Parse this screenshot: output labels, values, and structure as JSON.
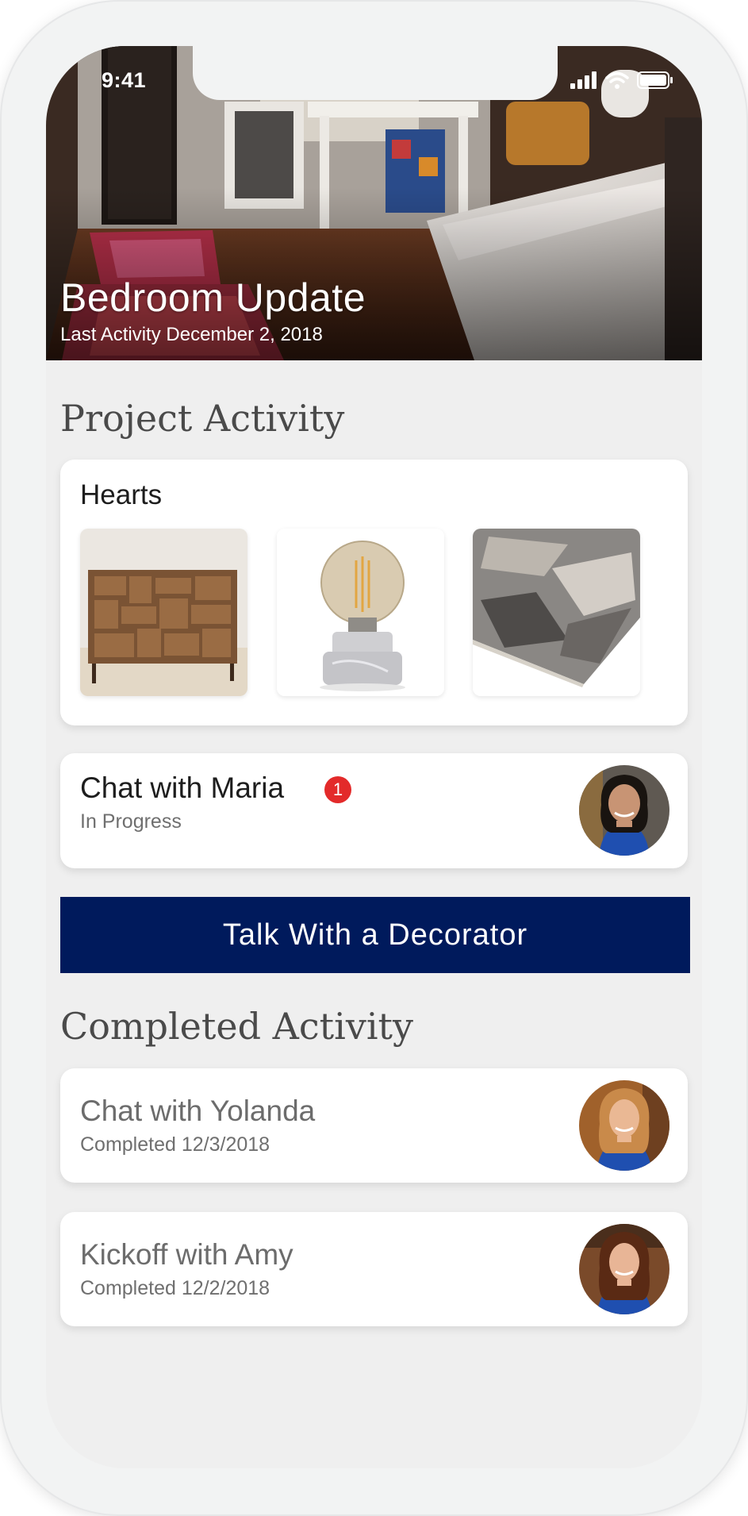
{
  "status_bar": {
    "time": "9:41"
  },
  "hero": {
    "title": "Bedroom Update",
    "subtitle": "Last Activity December 2, 2018"
  },
  "project_activity": {
    "heading": "Project Activity",
    "hearts": {
      "label": "Hearts",
      "items": [
        {
          "name": "wood-dresser"
        },
        {
          "name": "marble-lamp"
        },
        {
          "name": "gray-rug"
        }
      ]
    },
    "chat": {
      "title": "Chat with Maria",
      "badge": "1",
      "status": "In Progress"
    }
  },
  "cta": {
    "label": "Talk With a Decorator"
  },
  "completed_activity": {
    "heading": "Completed Activity",
    "items": [
      {
        "title": "Chat with Yolanda",
        "status": "Completed 12/3/2018"
      },
      {
        "title": "Kickoff with Amy",
        "status": "Completed 12/2/2018"
      }
    ]
  },
  "colors": {
    "cta_background": "#001a5c",
    "badge": "#e32a2a",
    "screen_background": "#efefef"
  }
}
